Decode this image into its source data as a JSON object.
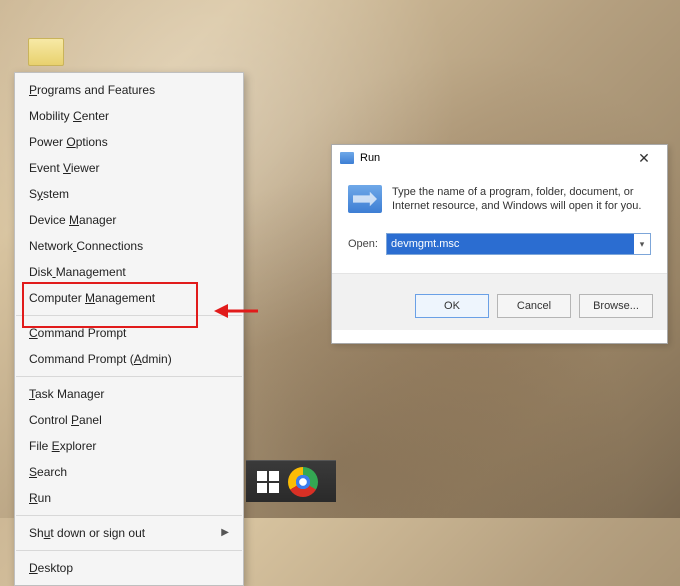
{
  "menu": {
    "items": [
      "Programs and Features",
      "Mobility Center",
      "Power Options",
      "Event Viewer",
      "System",
      "Device Manager",
      "Network Connections",
      "Disk Management",
      "Computer Management",
      "Command Prompt",
      "Command Prompt (Admin)",
      "Task Manager",
      "Control Panel",
      "File Explorer",
      "Search",
      "Run",
      "Shut down or sign out",
      "Desktop"
    ],
    "accel": {
      "0": 0,
      "1": 9,
      "2": 6,
      "3": 6,
      "4": 1,
      "5": 7,
      "6": 7,
      "7": 4,
      "8": 9,
      "9": 0,
      "10": 16,
      "11": 0,
      "12": 8,
      "13": 5,
      "14": 0,
      "15": 0,
      "16": 2,
      "17": 0
    },
    "separators_after": [
      8,
      10,
      15,
      16
    ],
    "submenu_at": 16
  },
  "run": {
    "title": "Run",
    "desc": "Type the name of a program, folder, document, or Internet resource, and Windows will open it for you.",
    "open_label": "Open:",
    "value": "devmgmt.msc",
    "buttons": {
      "ok": "OK",
      "cancel": "Cancel",
      "browse": "Browse..."
    }
  }
}
